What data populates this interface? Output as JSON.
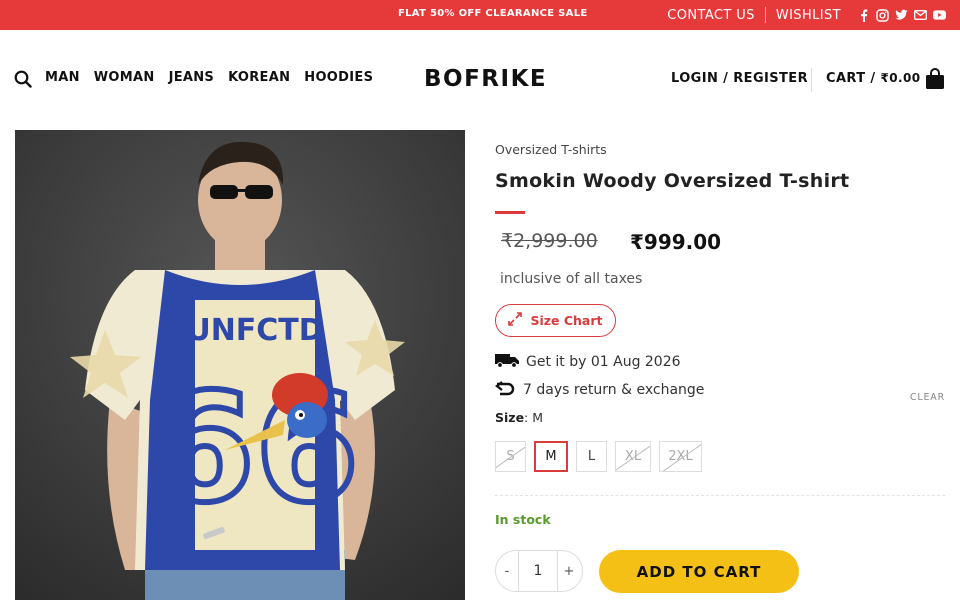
{
  "topbar": {
    "promo": "FLAT 50% OFF CLEARANCE SALE",
    "contact_label": "CONTACT US",
    "wishlist_label": "WISHLIST",
    "social_icons": [
      "facebook-icon",
      "instagram-icon",
      "twitter-icon",
      "email-icon",
      "youtube-icon"
    ]
  },
  "header": {
    "nav": [
      "MAN",
      "WOMAN",
      "JEANS",
      "KOREAN",
      "HOODIES"
    ],
    "logo": "BOFRIKE",
    "login_label": "LOGIN / REGISTER",
    "cart_label": "CART /",
    "cart_amount": "₹0.00"
  },
  "product": {
    "category": "Oversized T-shirts",
    "title": "Smokin Woody Oversized T-shirt",
    "old_price": "₹2,999.00",
    "new_price": "₹999.00",
    "tax_note": "inclusive of all taxes",
    "size_chart_label": "Size Chart",
    "delivery": "Get it by 01 Aug 2026",
    "returns": "7 days return & exchange",
    "size_label": "Size",
    "selected_size": "M",
    "clear_label": "CLEAR",
    "sizes": [
      {
        "label": "S",
        "available": false
      },
      {
        "label": "M",
        "available": true,
        "selected": true
      },
      {
        "label": "L",
        "available": true
      },
      {
        "label": "XL",
        "available": false
      },
      {
        "label": "2XL",
        "available": false
      }
    ],
    "stock": "In stock",
    "qty_minus": "-",
    "qty_value": "1",
    "qty_plus": "+",
    "add_to_cart": "ADD TO CART"
  },
  "colors": {
    "brand_red": "#e63a3a",
    "accent_yellow": "#f5c016",
    "stock_green": "#5a9a2a"
  }
}
